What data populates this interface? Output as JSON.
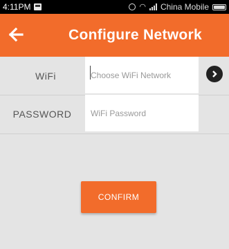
{
  "status_bar": {
    "time": "4:11PM",
    "carrier": "China Mobile"
  },
  "header": {
    "title": "Configure Network"
  },
  "form": {
    "wifi_label": "WiFi",
    "wifi_placeholder": "Choose WiFi Network",
    "password_label": "PASSWORD",
    "password_placeholder": "WiFi Password"
  },
  "confirm_label": "CONFIRM",
  "colors": {
    "accent": "#f26c2b",
    "background": "#e4e4e4",
    "status_bar": "#000000"
  },
  "icons": {
    "back": "arrow-left-icon",
    "arrow": "chevron-right-circle-icon"
  }
}
